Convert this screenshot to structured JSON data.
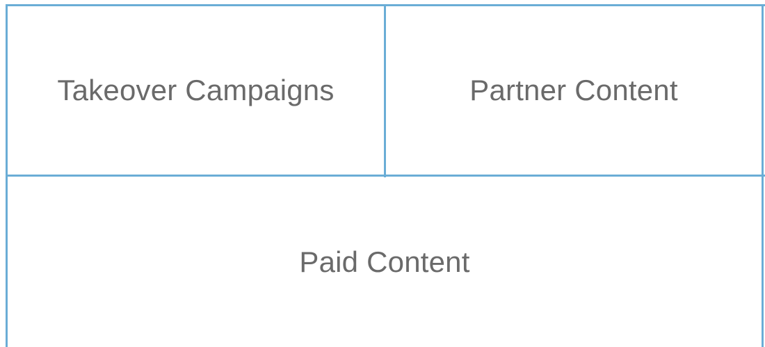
{
  "cells": {
    "top_left": {
      "label": "Takeover Campaigns"
    },
    "top_right": {
      "label": "Partner Content"
    },
    "bottom": {
      "label": "Paid Content"
    }
  },
  "colors": {
    "border": "#6aadd6",
    "text": "#6a6a6a",
    "background": "#ffffff"
  }
}
